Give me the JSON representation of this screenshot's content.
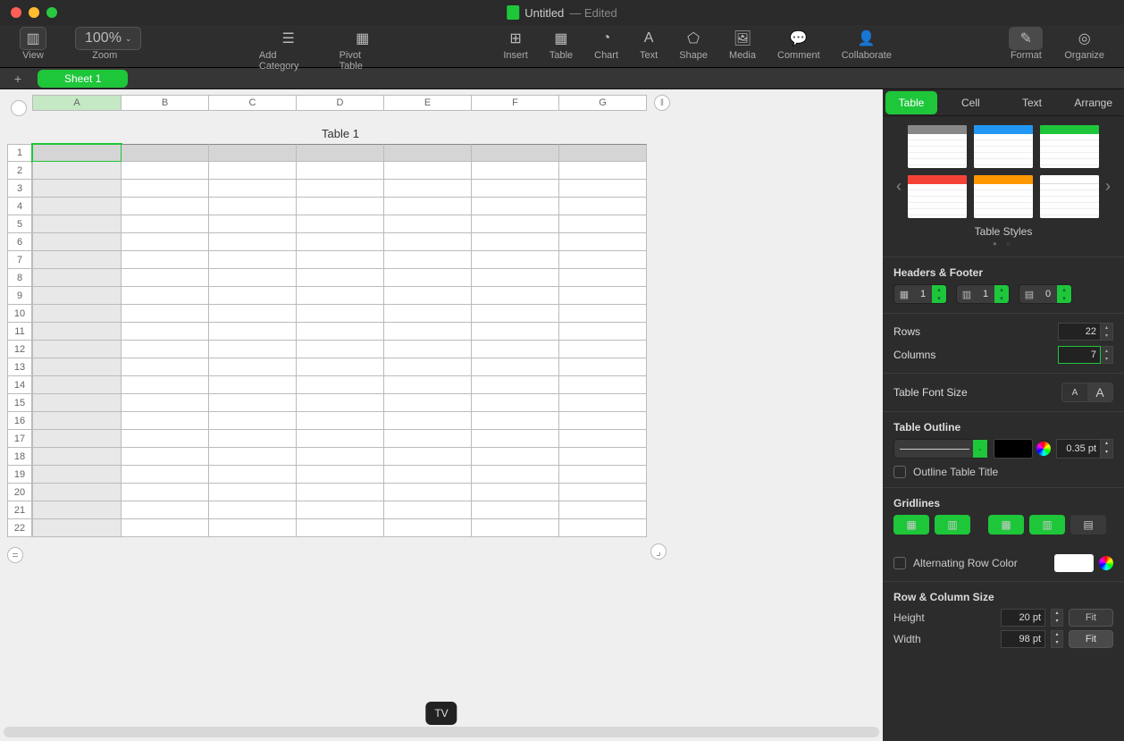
{
  "window": {
    "title": "Untitled",
    "status": "Edited"
  },
  "toolbar": {
    "view": "View",
    "zoom_value": "100%",
    "zoom": "Zoom",
    "add_category": "Add Category",
    "pivot": "Pivot Table",
    "insert": "Insert",
    "table": "Table",
    "chart": "Chart",
    "text": "Text",
    "shape": "Shape",
    "media": "Media",
    "comment": "Comment",
    "collaborate": "Collaborate",
    "format": "Format",
    "organize": "Organize"
  },
  "sheet_tabs": {
    "sheet1": "Sheet 1"
  },
  "spreadsheet": {
    "title": "Table 1",
    "columns": [
      "A",
      "B",
      "C",
      "D",
      "E",
      "F",
      "G"
    ],
    "rows": [
      "1",
      "2",
      "3",
      "4",
      "5",
      "6",
      "7",
      "8",
      "9",
      "10",
      "11",
      "12",
      "13",
      "14",
      "15",
      "16",
      "17",
      "18",
      "19",
      "20",
      "21",
      "22"
    ],
    "col_handle_glyph": "‖",
    "eq_glyph": "=",
    "br_glyph": "⌟"
  },
  "inspector": {
    "tabs": {
      "table": "Table",
      "cell": "Cell",
      "text": "Text",
      "arrange": "Arrange"
    },
    "styles_label": "Table Styles",
    "headers_footer": "Headers & Footer",
    "hf": {
      "header_rows": "1",
      "header_cols": "1",
      "footer_rows": "0"
    },
    "rows_label": "Rows",
    "rows_value": "22",
    "cols_label": "Columns",
    "cols_value": "7",
    "font_size_label": "Table Font Size",
    "small_a": "A",
    "big_a": "A",
    "outline_label": "Table Outline",
    "outline_pt": "0.35 pt",
    "outline_title": "Outline Table Title",
    "gridlines_label": "Gridlines",
    "alt_row_label": "Alternating Row Color",
    "size_label": "Row & Column Size",
    "height_label": "Height",
    "height_value": "20 pt",
    "width_label": "Width",
    "width_value": "98 pt",
    "fit": "Fit"
  },
  "tooltip": "TV"
}
